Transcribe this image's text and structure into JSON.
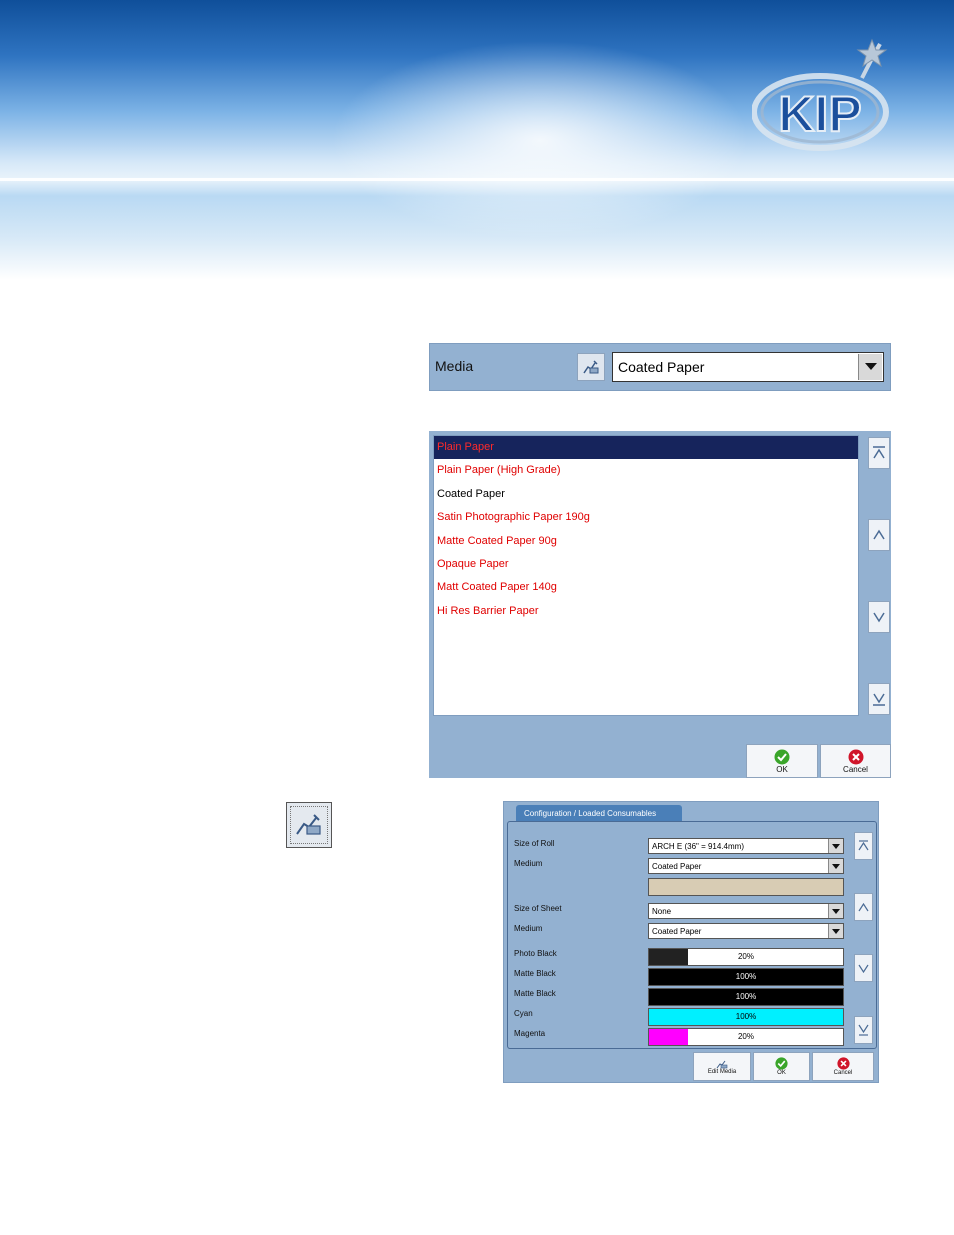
{
  "brand": {
    "logo_text": "KIP"
  },
  "media_bar": {
    "label": "Media",
    "selected_value": "Coated Paper",
    "edit_icon": "edit-media-icon"
  },
  "media_list": {
    "items": [
      {
        "label": "Plain Paper",
        "state": "selected"
      },
      {
        "label": "Plain Paper (High Grade)",
        "state": "unavailable"
      },
      {
        "label": "Coated Paper",
        "state": "available"
      },
      {
        "label": "Satin Photographic Paper 190g",
        "state": "unavailable"
      },
      {
        "label": "Matte Coated Paper 90g",
        "state": "unavailable"
      },
      {
        "label": "Opaque Paper",
        "state": "unavailable"
      },
      {
        "label": "Matt Coated Paper 140g",
        "state": "unavailable"
      },
      {
        "label": "Hi Res Barrier Paper",
        "state": "unavailable"
      }
    ],
    "ok_label": "OK",
    "cancel_label": "Cancel"
  },
  "config": {
    "tab_label": "Configuration / Loaded Consumables",
    "roll_size_label": "Size of Roll",
    "roll_size_value": "ARCH E (36\" = 914.4mm)",
    "roll_medium_label": "Medium",
    "roll_medium_value": "Coated Paper",
    "sheet_size_label": "Size of Sheet",
    "sheet_size_value": "None",
    "sheet_medium_label": "Medium",
    "sheet_medium_value": "Coated Paper",
    "inks": [
      {
        "name": "Photo Black",
        "level_text": "20%",
        "level": 0.2,
        "color": "#222222"
      },
      {
        "name": "Matte Black",
        "level_text": "100%",
        "level": 1.0,
        "color": "#000000"
      },
      {
        "name": "Matte Black",
        "level_text": "100%",
        "level": 1.0,
        "color": "#000000"
      },
      {
        "name": "Cyan",
        "level_text": "100%",
        "level": 1.0,
        "color": "#00f0ff"
      },
      {
        "name": "Magenta",
        "level_text": "20%",
        "level": 0.2,
        "color": "#ff00ff"
      }
    ],
    "edit_media_label": "Edit Media",
    "ok_label": "OK",
    "cancel_label": "Cancel"
  },
  "colors": {
    "panel": "#93b1d1",
    "selected_row": "#16245c",
    "unavailable_text": "#e00000",
    "ok_green": "#3aa52a",
    "cancel_red": "#d0152a"
  }
}
